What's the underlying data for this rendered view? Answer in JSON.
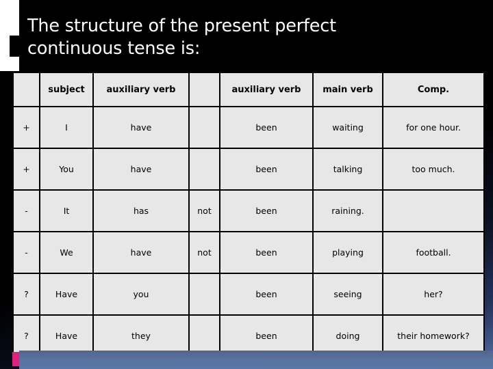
{
  "slide": {
    "title": "The structure of the present perfect\ncontinuous tense is:",
    "colors": {
      "background": "#000000",
      "accent_pink": "#e0217e",
      "footer_blue": "#59739f",
      "table_cell": "#e7e7e7",
      "table_border": "#000000",
      "title_text": "#ffffff"
    }
  },
  "table": {
    "headers": [
      "",
      "subject",
      "auxiliary verb",
      "",
      "auxiliary verb",
      "main verb",
      "Comp."
    ],
    "rows": [
      {
        "mark": "+",
        "subject": "I",
        "aux1": "have",
        "neg": "",
        "aux2": "been",
        "main": "waiting",
        "comp": "for one hour."
      },
      {
        "mark": "+",
        "subject": "You",
        "aux1": "have",
        "neg": "",
        "aux2": "been",
        "main": "talking",
        "comp": "too much."
      },
      {
        "mark": "-",
        "subject": "It",
        "aux1": "has",
        "neg": "not",
        "aux2": "been",
        "main": "raining.",
        "comp": ""
      },
      {
        "mark": "-",
        "subject": "We",
        "aux1": "have",
        "neg": "not",
        "aux2": "been",
        "main": "playing",
        "comp": "football."
      },
      {
        "mark": "?",
        "subject": "Have",
        "aux1": "you",
        "neg": "",
        "aux2": "been",
        "main": "seeing",
        "comp": "her?"
      },
      {
        "mark": "?",
        "subject": "Have",
        "aux1": "they",
        "neg": "",
        "aux2": "been",
        "main": "doing",
        "comp": "their homework?"
      }
    ]
  }
}
